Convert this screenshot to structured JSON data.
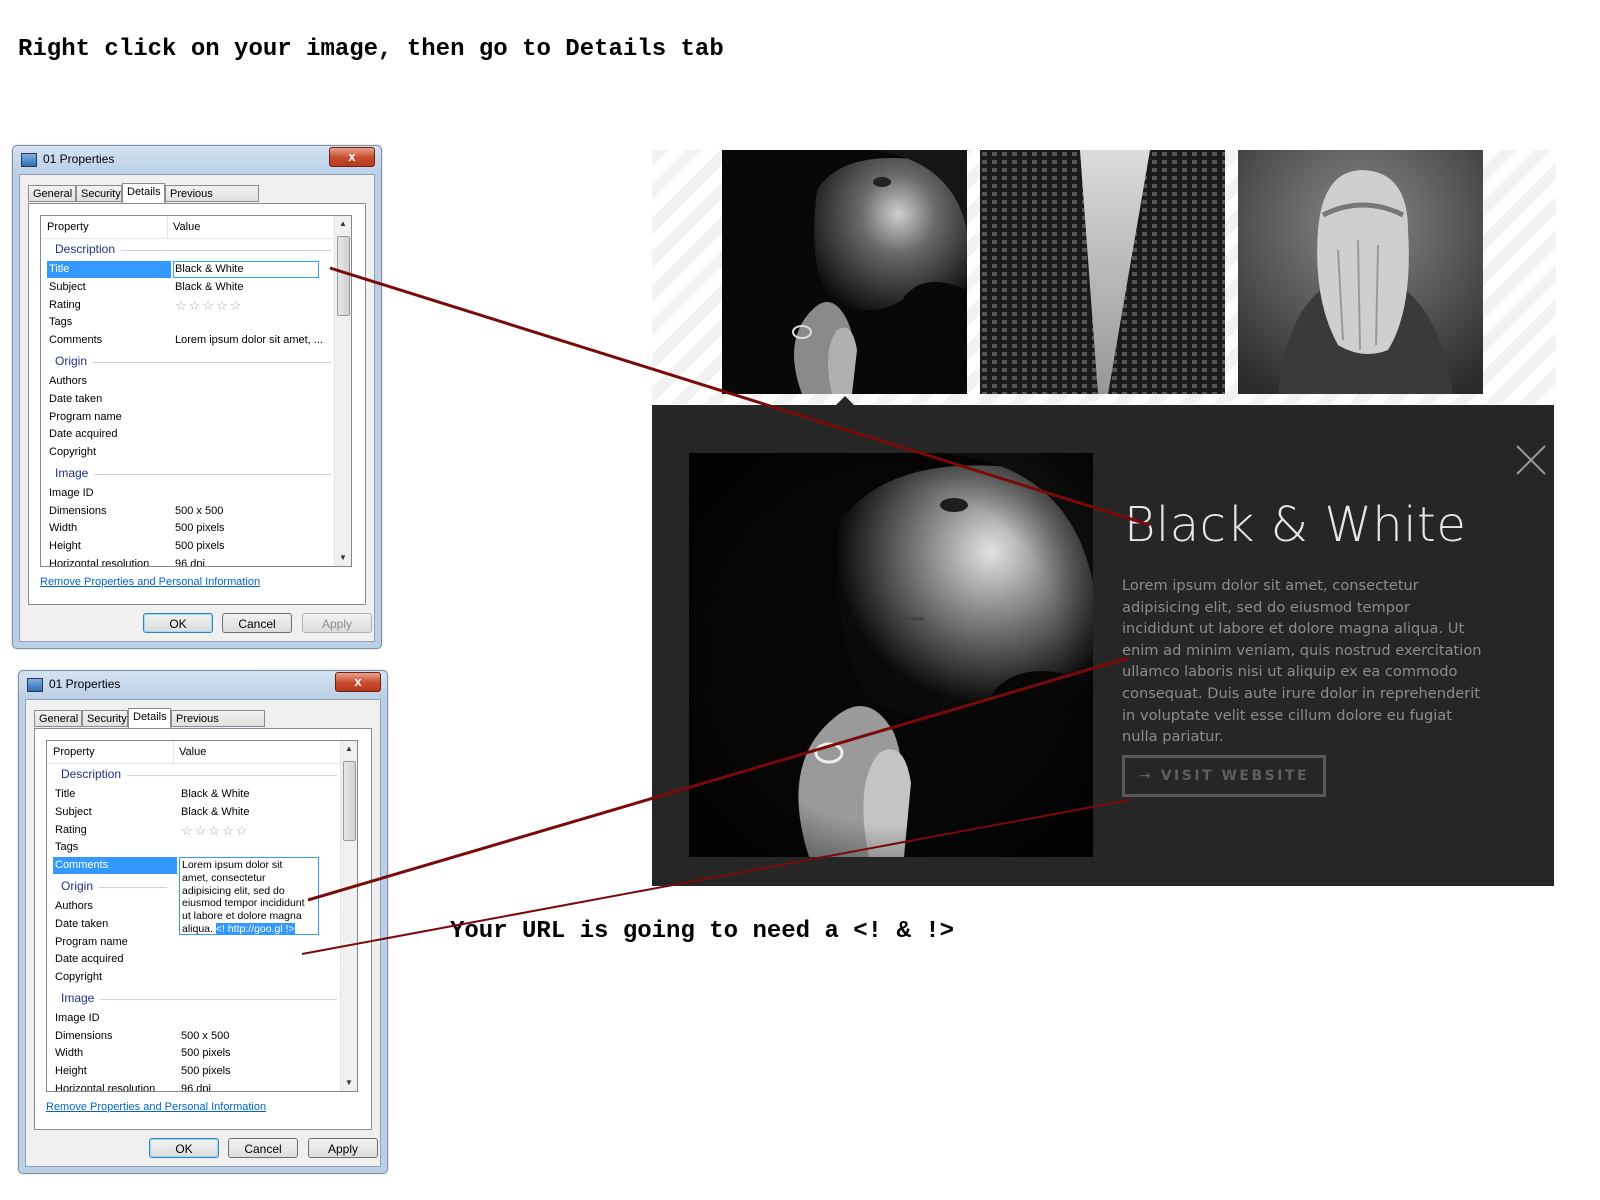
{
  "instructions": {
    "top": "Right click on your image, then go to Details tab",
    "bottom": "Your URL is going to need a <! & !>"
  },
  "dialog": {
    "title": "01 Properties",
    "close_glyph": "x",
    "tabs": [
      "General",
      "Security",
      "Details",
      "Previous Versions"
    ],
    "active_tab": "Details",
    "columns": {
      "property": "Property",
      "value": "Value"
    },
    "groups": {
      "description": "Description",
      "origin": "Origin",
      "image": "Image"
    },
    "properties": {
      "title": {
        "label": "Title",
        "value": "Black & White"
      },
      "subject": {
        "label": "Subject",
        "value": "Black & White"
      },
      "rating": {
        "label": "Rating",
        "value": "☆☆☆☆☆"
      },
      "tags": {
        "label": "Tags",
        "value": ""
      },
      "comments": {
        "label": "Comments",
        "value": "Lorem ipsum dolor sit amet, ..."
      },
      "authors": {
        "label": "Authors"
      },
      "date_taken": {
        "label": "Date taken"
      },
      "program_name": {
        "label": "Program name"
      },
      "date_acquired": {
        "label": "Date acquired"
      },
      "copyright": {
        "label": "Copyright"
      },
      "image_id": {
        "label": "Image ID"
      },
      "dimensions": {
        "label": "Dimensions",
        "value": "500 x 500"
      },
      "width": {
        "label": "Width",
        "value": "500 pixels"
      },
      "height": {
        "label": "Height",
        "value": "500 pixels"
      },
      "horizontal_resolution": {
        "label": "Horizontal resolution",
        "value": "96 dpi"
      }
    },
    "comments_full": "Lorem ipsum dolor sit\namet, consectetur\nadipisicing elit, sed do\neiusmod tempor incididunt\nut labore et dolore magna\naliqua. ",
    "comments_url": "<! http://goo.gl !>",
    "remove_link": "Remove Properties and Personal Information",
    "buttons": {
      "ok": "OK",
      "cancel": "Cancel",
      "apply": "Apply"
    }
  },
  "lightbox": {
    "title": "Black & White",
    "description": "Lorem ipsum dolor sit amet, consectetur adipisicing elit, sed do eiusmod tempor incididunt ut labore et dolore magna aliqua. Ut enim ad minim veniam, quis nostrud exercitation ullamco laboris nisi ut aliquip ex ea commodo consequat. Duis aute irure dolor in reprehenderit in voluptate velit esse cillum dolore eu fugiat nulla pariatur.",
    "button_label": "VISIT WEBSITE",
    "button_arrow": "→"
  },
  "colors": {
    "annotation_line": "#7a0a0a",
    "panel_bg": "#262626",
    "selection": "#3399ff"
  }
}
